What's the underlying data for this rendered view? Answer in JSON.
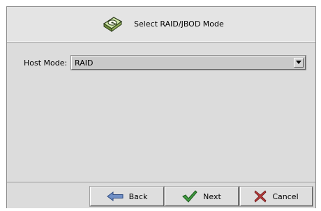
{
  "dialog": {
    "title": "Select RAID/JBOD Mode",
    "header_icon": "hard-drive-icon"
  },
  "form": {
    "host_mode_label": "Host Mode:",
    "host_mode_value": "RAID"
  },
  "buttons": {
    "back_label": "Back",
    "next_label": "Next",
    "cancel_label": "Cancel",
    "back_icon": "arrow-left-icon",
    "next_icon": "checkmark-icon",
    "cancel_icon": "close-icon"
  },
  "colors": {
    "frame_bg": "#dcdcdc",
    "next_check": "#2f8a2f",
    "cancel_x": "#b03030",
    "back_arrow": "#3a5f9c"
  }
}
